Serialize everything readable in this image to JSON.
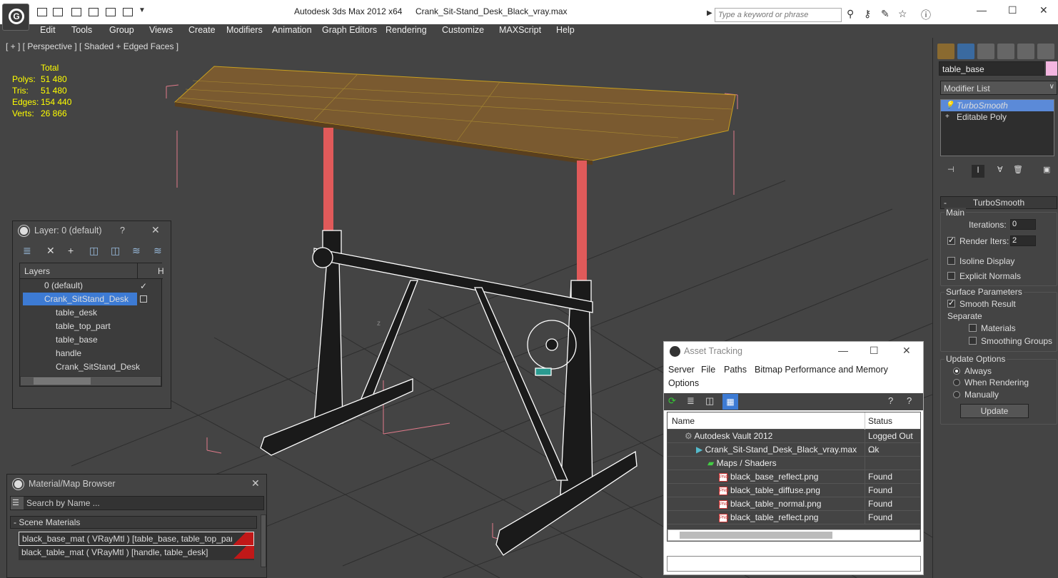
{
  "app": {
    "title": "Autodesk 3ds Max  2012 x64",
    "document": "Crank_Sit-Stand_Desk_Black_vray.max",
    "search_placeholder": "Type a keyword or phrase"
  },
  "menu": [
    "Edit",
    "Tools",
    "Group",
    "Views",
    "Create",
    "Modifiers",
    "Animation",
    "Graph Editors",
    "Rendering",
    "Customize",
    "MAXScript",
    "Help"
  ],
  "viewport": {
    "label": "[ + ] [ Perspective ] [ Shaded + Edged Faces ]",
    "stats": {
      "header": "Total",
      "polys_label": "Polys:",
      "polys": "51 480",
      "tris_label": "Tris:",
      "tris": "51 480",
      "edges_label": "Edges:",
      "edges": "154 440",
      "verts_label": "Verts:",
      "verts": "26 866"
    },
    "axis_label": "z"
  },
  "command_panel": {
    "object_name": "table_base",
    "object_color": "#f4b6e0",
    "modifier_list": "Modifier List",
    "stack": [
      "TurboSmooth",
      "Editable Poly"
    ],
    "turbosmooth": {
      "title": "TurboSmooth",
      "main_group": "Main",
      "iterations_label": "Iterations:",
      "iterations": "0",
      "render_iters_label": "Render Iters:",
      "render_iters": "2",
      "isoline": "Isoline Display",
      "explicit": "Explicit Normals",
      "surface_group": "Surface Parameters",
      "smooth_result": "Smooth Result",
      "separate": "Separate",
      "materials": "Materials",
      "smoothing_groups": "Smoothing Groups",
      "update_group": "Update Options",
      "always": "Always",
      "when_rendering": "When Rendering",
      "manually": "Manually",
      "update_btn": "Update"
    }
  },
  "layer_panel": {
    "title": "Layer: 0 (default)",
    "help": "?",
    "column": "Layers",
    "column2": "H",
    "rows": [
      "0 (default)",
      "Crank_SitStand_Desk",
      "table_desk",
      "table_top_part",
      "table_base",
      "handle",
      "Crank_SitStand_Desk"
    ]
  },
  "asset_tracking": {
    "title": "Asset Tracking",
    "menu": [
      "Server",
      "File",
      "Paths",
      "Bitmap Performance and Memory"
    ],
    "menu2": "Options",
    "col_name": "Name",
    "col_status": "Status",
    "rows": [
      {
        "name": "Autodesk Vault 2012",
        "status": "Logged Out ..."
      },
      {
        "name": "Crank_Sit-Stand_Desk_Black_vray.max",
        "status": "Ok"
      },
      {
        "name": "Maps / Shaders",
        "status": ""
      },
      {
        "name": "black_base_reflect.png",
        "status": "Found"
      },
      {
        "name": "black_table_diffuse.png",
        "status": "Found"
      },
      {
        "name": "black_table_normal.png",
        "status": "Found"
      },
      {
        "name": "black_table_reflect.png",
        "status": "Found"
      }
    ],
    "png_tag": "PNG"
  },
  "material_browser": {
    "title": "Material/Map Browser",
    "search": "Search by Name ...",
    "group": "Scene Materials",
    "items": [
      "black_base_mat  ( VRayMtl ) [table_base, table_top_part]",
      "black_table_mat  ( VRayMtl ) [handle, table_desk]"
    ]
  }
}
